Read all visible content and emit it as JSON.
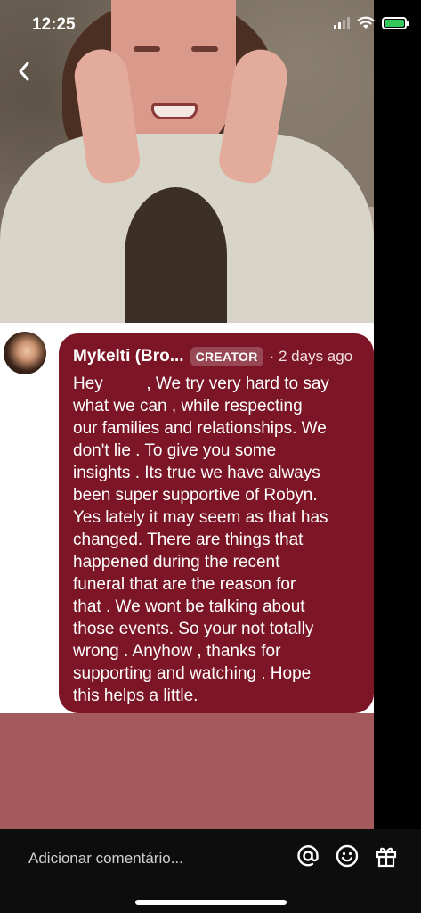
{
  "status_bar": {
    "time": "12:25"
  },
  "comment": {
    "author": "Mykelti (Bro...",
    "badge": "CREATOR",
    "time_ago": "· 2 days ago",
    "text": "Hey    , We try very hard to say\nwhat we can , while respecting\nour families and relationships. We\ndon't lie . To give you some\ninsights . Its true we have always\nbeen super supportive of Robyn.\nYes lately it may seem as that has\nchanged. There are things that\nhappened during the recent\nfuneral that are the reason for\nthat . We wont be talking about\nthose events.  So your not totally\nwrong . Anyhow , thanks for\nsupporting and watching . Hope\nthis helps  a little."
  },
  "bottom_bar": {
    "placeholder": "Adicionar comentário..."
  },
  "colors": {
    "bubble": "#7c1525",
    "pink_area": "#a4595d",
    "battery": "#34c759"
  },
  "icons": [
    "back-arrow-icon",
    "signal-icon",
    "wifi-icon",
    "battery-icon",
    "mention-icon",
    "emoji-icon",
    "gift-icon"
  ]
}
